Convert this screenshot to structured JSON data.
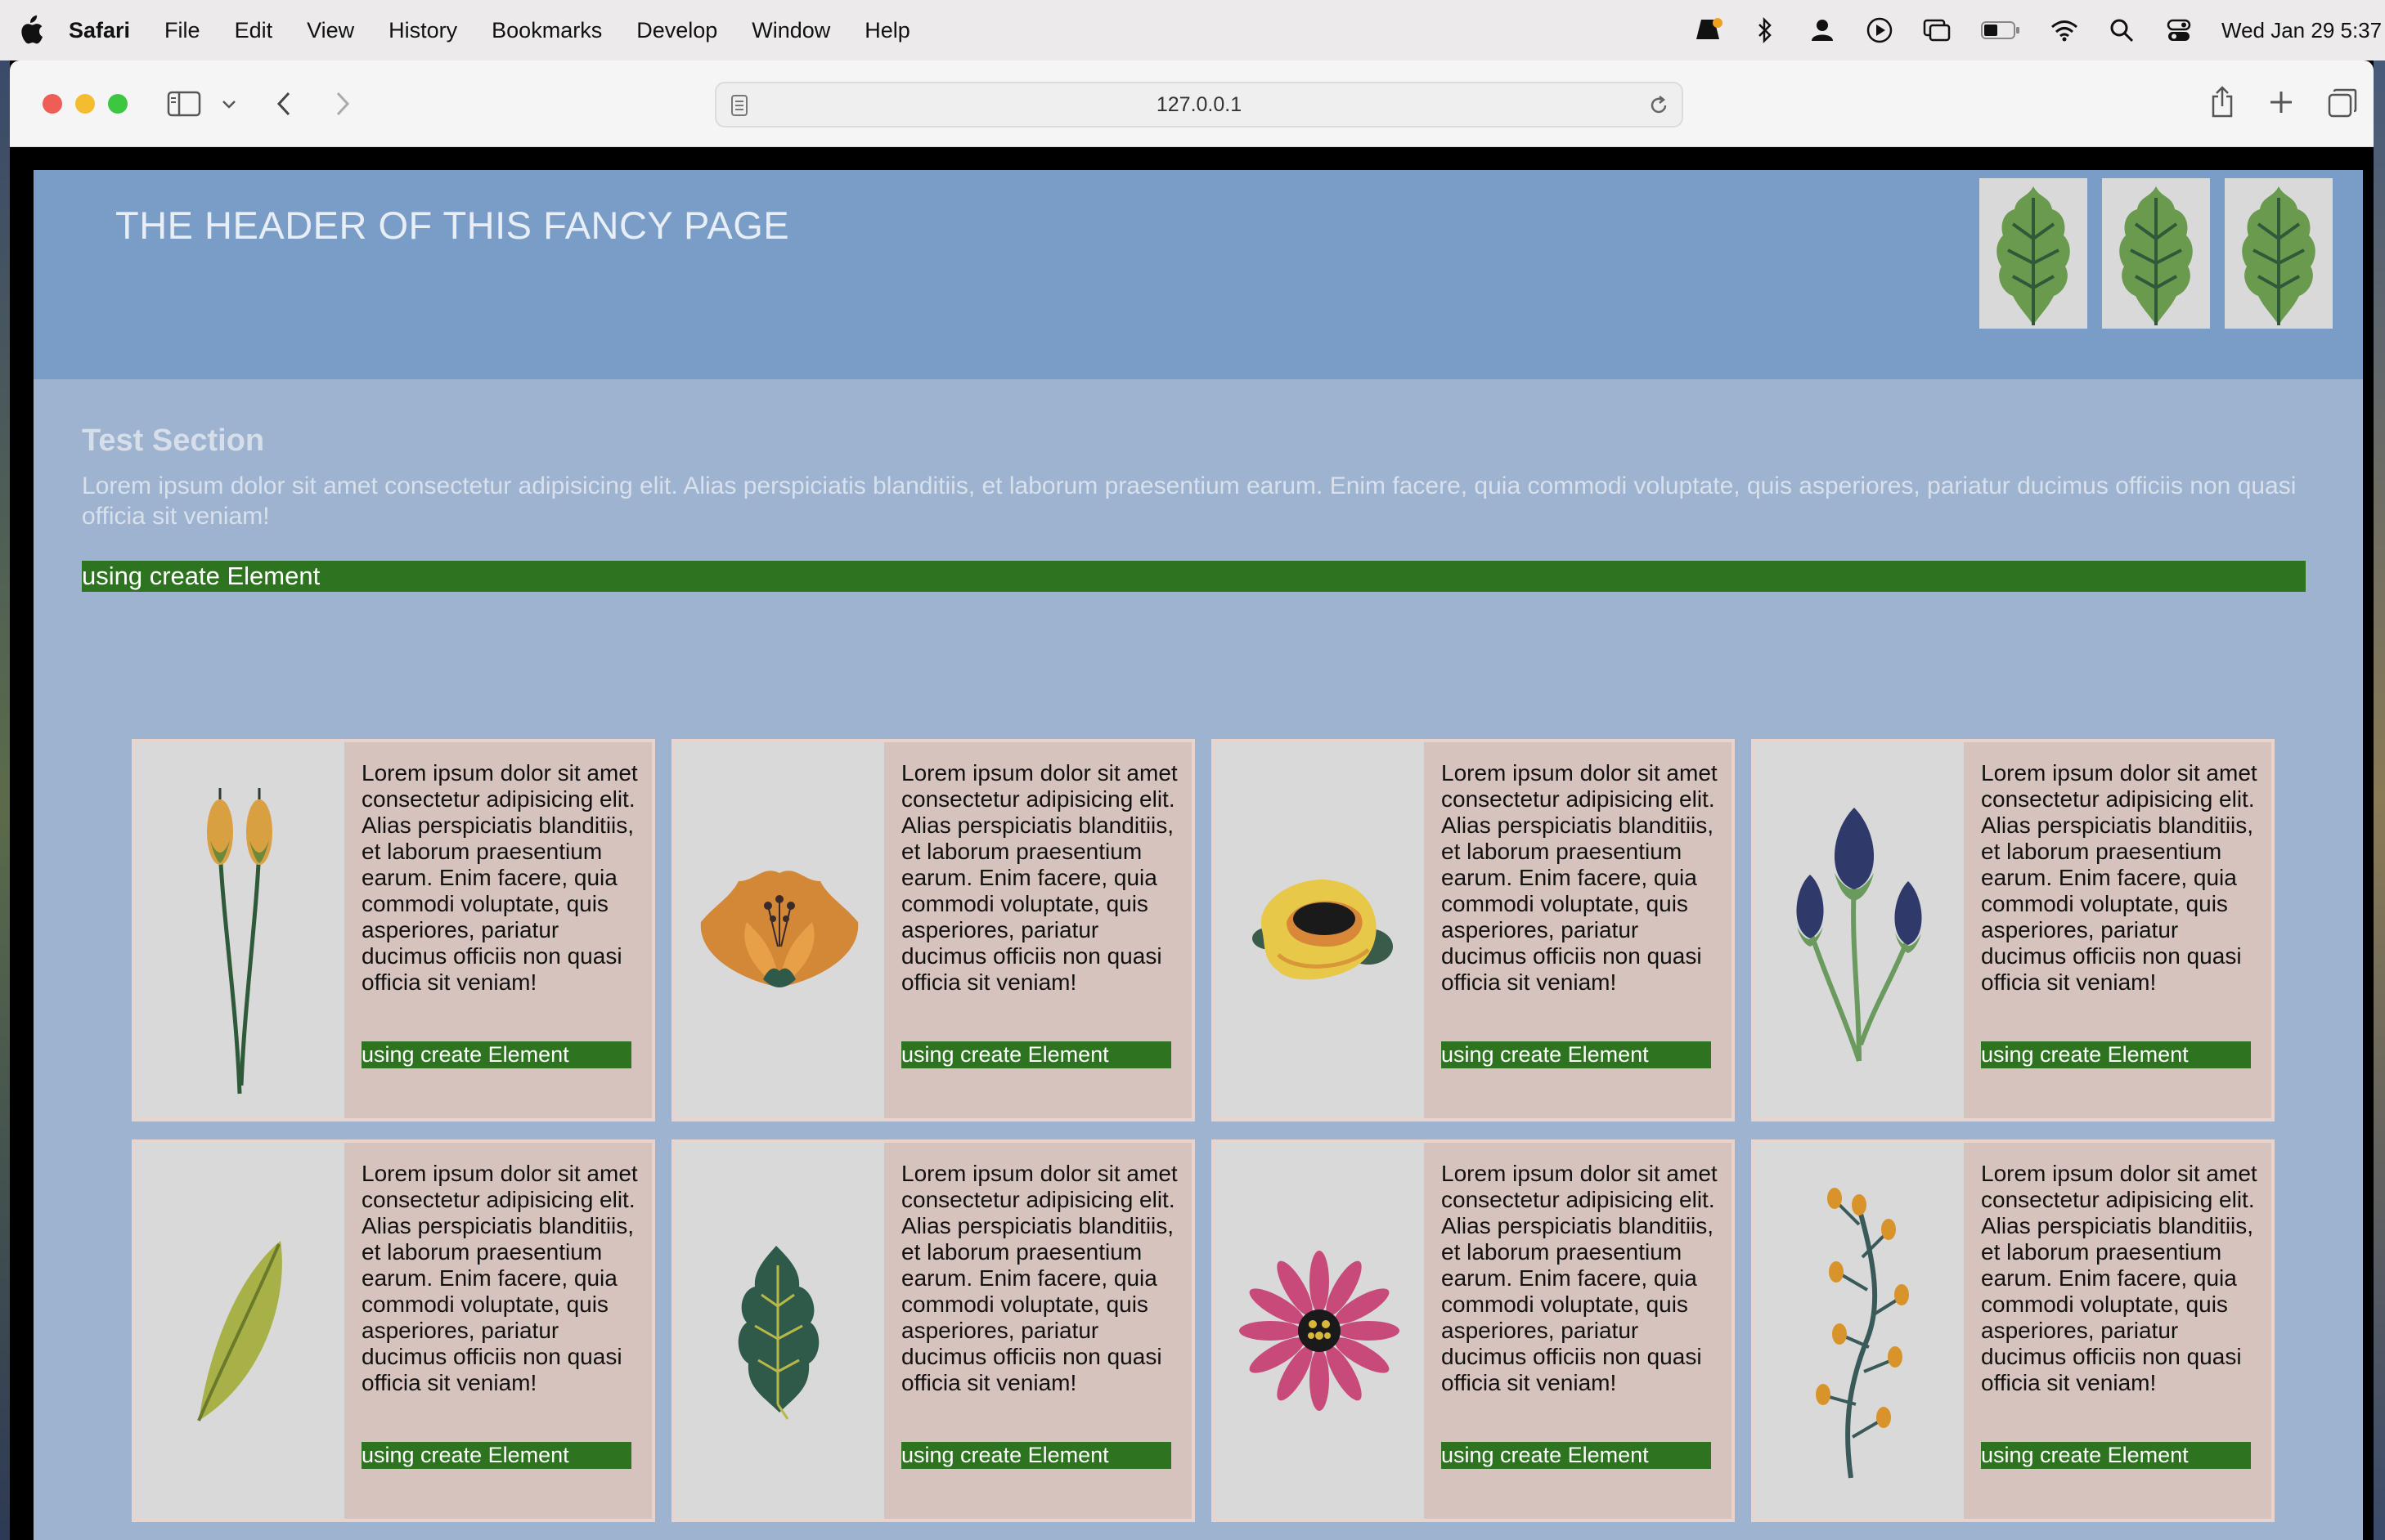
{
  "menubar": {
    "app_name": "Safari",
    "items": [
      "File",
      "Edit",
      "View",
      "History",
      "Bookmarks",
      "Develop",
      "Window",
      "Help"
    ],
    "clock": "Wed Jan 29  5:37"
  },
  "browser": {
    "url": "127.0.0.1"
  },
  "page": {
    "header_title": "THE HEADER OF THIS FANCY PAGE",
    "section_title": "Test Section",
    "section_text": "Lorem ipsum dolor sit amet consectetur adipisicing elit. Alias perspiciatis blanditiis, et laborum praesentium earum. Enim facere, quia commodi voluptate, quis asperiores, pariatur ducimus officiis non quasi officia sit veniam!",
    "banner_label": "using create Element",
    "cards": [
      {
        "image": "yellow-buds-plant",
        "text": "Lorem ipsum dolor sit amet consectetur adipisicing elit. Alias perspiciatis blanditiis, et laborum praesentium earum. Enim facere, quia commodi voluptate, quis asperiores, pariatur ducimus officiis non quasi officia sit veniam!",
        "button": "using create Element"
      },
      {
        "image": "orange-flower",
        "text": "Lorem ipsum dolor sit amet consectetur adipisicing elit. Alias perspiciatis blanditiis, et laborum praesentium earum. Enim facere, quia commodi voluptate, quis asperiores, pariatur ducimus officiis non quasi officia sit veniam!",
        "button": "using create Element"
      },
      {
        "image": "yellow-rose",
        "text": "Lorem ipsum dolor sit amet consectetur adipisicing elit. Alias perspiciatis blanditiis, et laborum praesentium earum. Enim facere, quia commodi voluptate, quis asperiores, pariatur ducimus officiis non quasi officia sit veniam!",
        "button": "using create Element"
      },
      {
        "image": "blue-thistle",
        "text": "Lorem ipsum dolor sit amet consectetur adipisicing elit. Alias perspiciatis blanditiis, et laborum praesentium earum. Enim facere, quia commodi voluptate, quis asperiores, pariatur ducimus officiis non quasi officia sit veniam!",
        "button": "using create Element"
      },
      {
        "image": "olive-leaf",
        "text": "Lorem ipsum dolor sit amet consectetur adipisicing elit. Alias perspiciatis blanditiis, et laborum praesentium earum. Enim facere, quia commodi voluptate, quis asperiores, pariatur ducimus officiis non quasi officia sit veniam!",
        "button": "using create Element"
      },
      {
        "image": "dark-green-leaf",
        "text": "Lorem ipsum dolor sit amet consectetur adipisicing elit. Alias perspiciatis blanditiis, et laborum praesentium earum. Enim facere, quia commodi voluptate, quis asperiores, pariatur ducimus officiis non quasi officia sit veniam!",
        "button": "using create Element"
      },
      {
        "image": "pink-daisy",
        "text": "Lorem ipsum dolor sit amet consectetur adipisicing elit. Alias perspiciatis blanditiis, et laborum praesentium earum. Enim facere, quia commodi voluptate, quis asperiores, pariatur ducimus officiis non quasi officia sit veniam!",
        "button": "using create Element"
      },
      {
        "image": "orange-berry-branch",
        "text": "Lorem ipsum dolor sit amet consectetur adipisicing elit. Alias perspiciatis blanditiis, et laborum praesentium earum. Enim facere, quia commodi voluptate, quis asperiores, pariatur ducimus officiis non quasi officia sit veniam!",
        "button": "using create Element"
      }
    ]
  },
  "colors": {
    "header_bg": "#7a9dc8",
    "page_bg": "#9db3cf",
    "accent_green": "#2e7420",
    "card_bg": "#d7c3bd"
  }
}
